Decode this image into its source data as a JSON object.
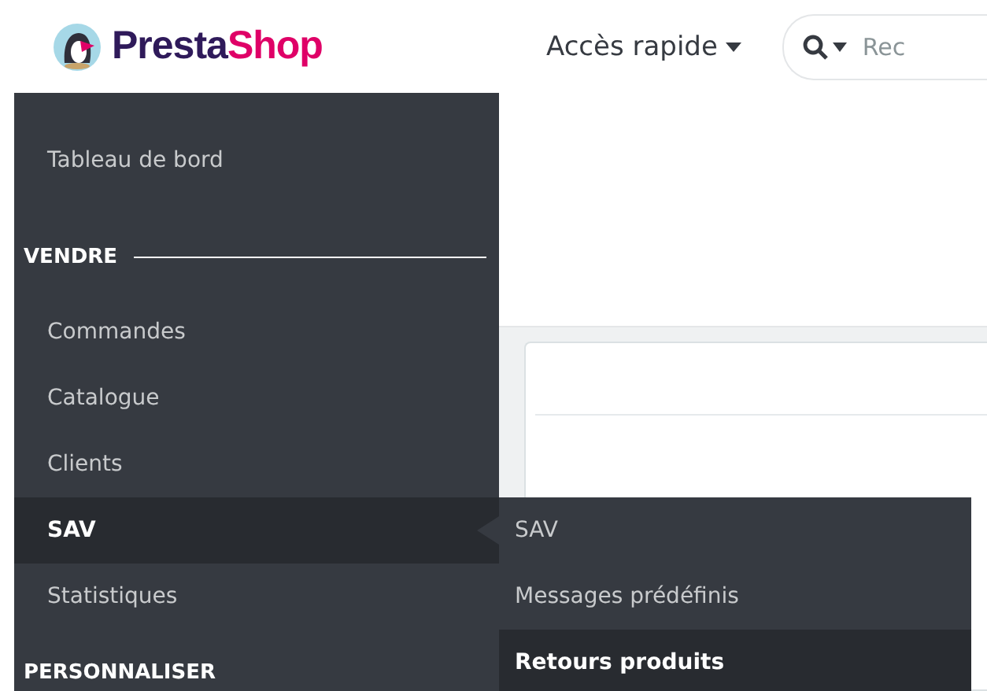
{
  "header": {
    "logo": {
      "parts": [
        {
          "text": "Presta",
          "color": "#2f1a5a"
        },
        {
          "text": "Shop",
          "color": "#df0067"
        }
      ]
    },
    "quick_access": {
      "label": "Accès rapide"
    },
    "search": {
      "placeholder": "Rec"
    }
  },
  "sidebar": {
    "items": [
      {
        "kind": "link",
        "label": "Tableau de bord",
        "selected": false
      },
      {
        "kind": "section",
        "label": "VENDRE"
      },
      {
        "kind": "link",
        "label": "Commandes",
        "selected": false
      },
      {
        "kind": "link",
        "label": "Catalogue",
        "selected": false
      },
      {
        "kind": "link",
        "label": "Clients",
        "selected": false
      },
      {
        "kind": "link",
        "label": "SAV",
        "selected": true
      },
      {
        "kind": "link",
        "label": "Statistiques",
        "selected": false
      },
      {
        "kind": "section",
        "label": "PERSONNALISER"
      }
    ]
  },
  "submenu": {
    "items": [
      {
        "label": "SAV",
        "selected": false
      },
      {
        "label": "Messages prédéfinis",
        "selected": false
      },
      {
        "label": "Retours produits",
        "selected": true
      }
    ]
  }
}
